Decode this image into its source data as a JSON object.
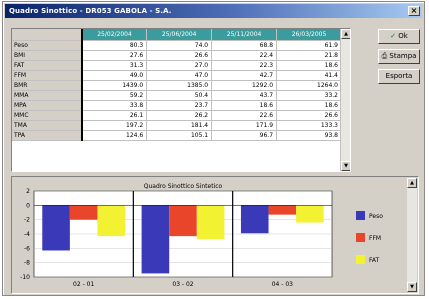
{
  "window": {
    "title": "Quadro Sinottico - DR053 GABOLA - S.A."
  },
  "buttons": {
    "ok": "Ok",
    "print": "Stampa",
    "export": "Esporta"
  },
  "grid": {
    "columns": [
      "25/02/2004",
      "25/06/2004",
      "25/11/2004",
      "26/03/2005"
    ],
    "rows": [
      {
        "label": "Peso",
        "values": [
          "80.3",
          "74.0",
          "68.8",
          "61.9"
        ]
      },
      {
        "label": "BMI",
        "values": [
          "27.6",
          "26.6",
          "22.4",
          "21.8"
        ]
      },
      {
        "label": "FAT",
        "values": [
          "31.3",
          "27.0",
          "22.3",
          "18.6"
        ]
      },
      {
        "label": "FFM",
        "values": [
          "49.0",
          "47.0",
          "42.7",
          "41.4"
        ]
      },
      {
        "label": "BMR",
        "values": [
          "1439.0",
          "1385.0",
          "1292.0",
          "1264.0"
        ]
      },
      {
        "label": "MMA",
        "values": [
          "59.2",
          "50.4",
          "43.7",
          "33.2"
        ]
      },
      {
        "label": "MPA",
        "values": [
          "33.8",
          "23.7",
          "18.6",
          "18.6"
        ]
      },
      {
        "label": "MMC",
        "values": [
          "26.1",
          "26.2",
          "22.6",
          "26.6"
        ]
      },
      {
        "label": "TMA",
        "values": [
          "197.2",
          "181.4",
          "171.9",
          "133.3"
        ]
      },
      {
        "label": "TPA",
        "values": [
          "124.6",
          "105.1",
          "96.7",
          "93.8"
        ]
      }
    ]
  },
  "chart_data": {
    "type": "bar",
    "title": "Quadro Sinottico Sintetico",
    "categories": [
      "02 - 01",
      "03 - 02",
      "04 - 03"
    ],
    "series": [
      {
        "name": "Peso",
        "color": "#3a3ab8",
        "values": [
          -6.3,
          -9.5,
          -3.9
        ]
      },
      {
        "name": "FFM",
        "color": "#e8452a",
        "values": [
          -2.0,
          -4.3,
          -1.3
        ]
      },
      {
        "name": "FAT",
        "color": "#f2f232",
        "values": [
          -4.3,
          -4.7,
          -2.4
        ]
      }
    ],
    "yticks": [
      "2",
      "0",
      "-2",
      "-4",
      "-6",
      "-8",
      "-10"
    ],
    "ylim": [
      -10,
      2
    ],
    "legend": "right"
  }
}
